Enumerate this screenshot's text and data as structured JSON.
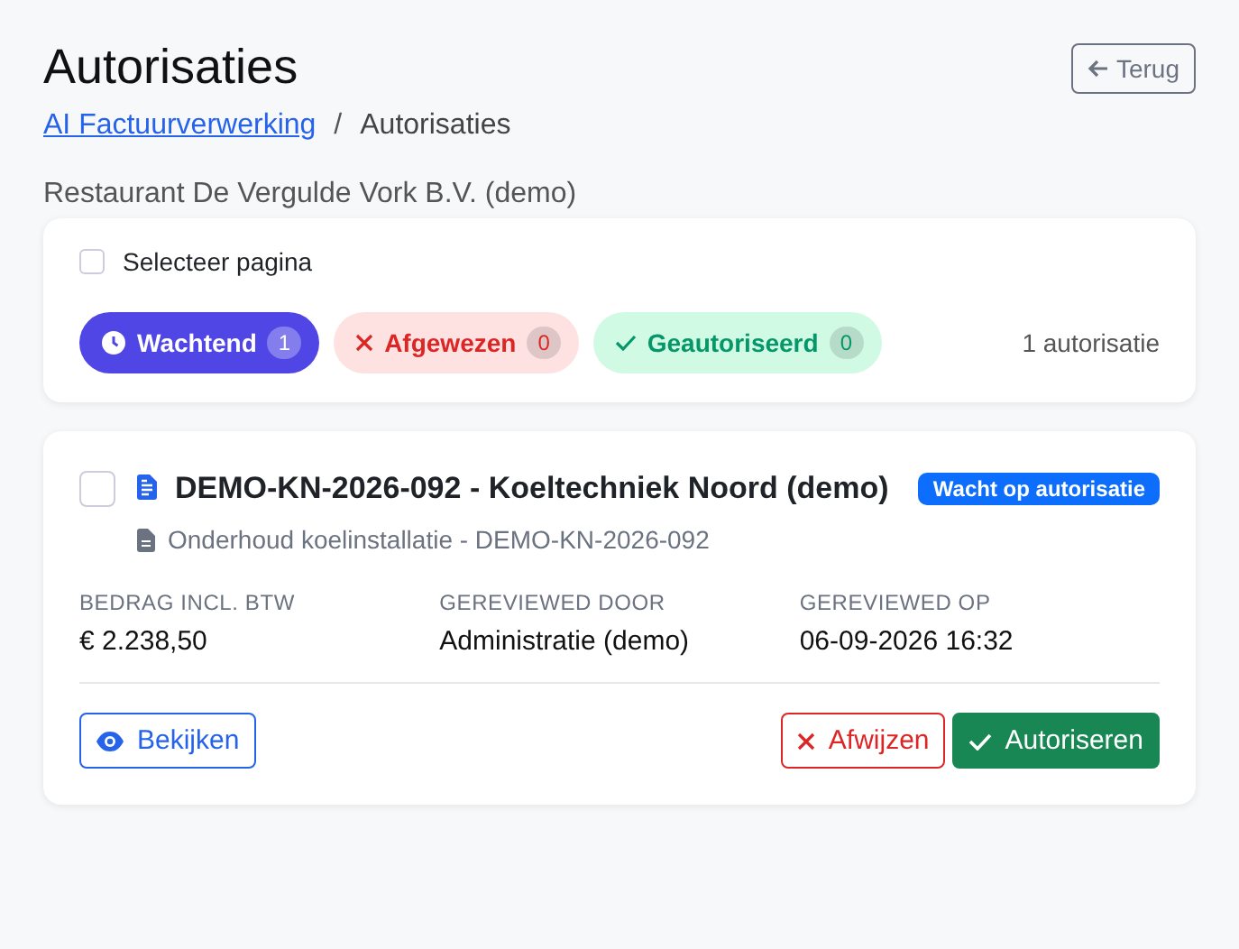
{
  "header": {
    "title": "Autorisaties",
    "back_button": "Terug"
  },
  "breadcrumb": {
    "link": "AI Factuurverwerking",
    "separator": "/",
    "current": "Autorisaties"
  },
  "company": "Restaurant De Vergulde Vork B.V. (demo)",
  "filter_panel": {
    "select_page": {
      "label": "Selecteer pagina",
      "checked": false
    },
    "filters": [
      {
        "kind": "pending",
        "label": "Wachtend",
        "count": "1",
        "selected": true
      },
      {
        "kind": "rejected",
        "label": "Afgewezen",
        "count": "0",
        "selected": false
      },
      {
        "kind": "approved",
        "label": "Geautoriseerd",
        "count": "0",
        "selected": false
      }
    ],
    "total": "1 autorisatie"
  },
  "items": [
    {
      "checked": false,
      "title": "DEMO-KN-2026-092 - Koeltechniek Noord (demo)",
      "status": "Wacht op autorisatie",
      "subtitle": "Onderhoud koelinstallatie - DEMO-KN-2026-092",
      "fields": [
        {
          "label": "BEDRAG INCL. BTW",
          "value": "€ 2.238,50"
        },
        {
          "label": "GEREVIEWED DOOR",
          "value": "Administratie (demo)"
        },
        {
          "label": "GEREVIEWED OP",
          "value": "06-09-2026 16:32"
        }
      ],
      "actions": [
        {
          "kind": "view",
          "label": "Bekijken"
        },
        {
          "kind": "reject",
          "label": "Afwijzen"
        },
        {
          "kind": "approve",
          "label": "Autoriseren"
        }
      ]
    }
  ]
}
